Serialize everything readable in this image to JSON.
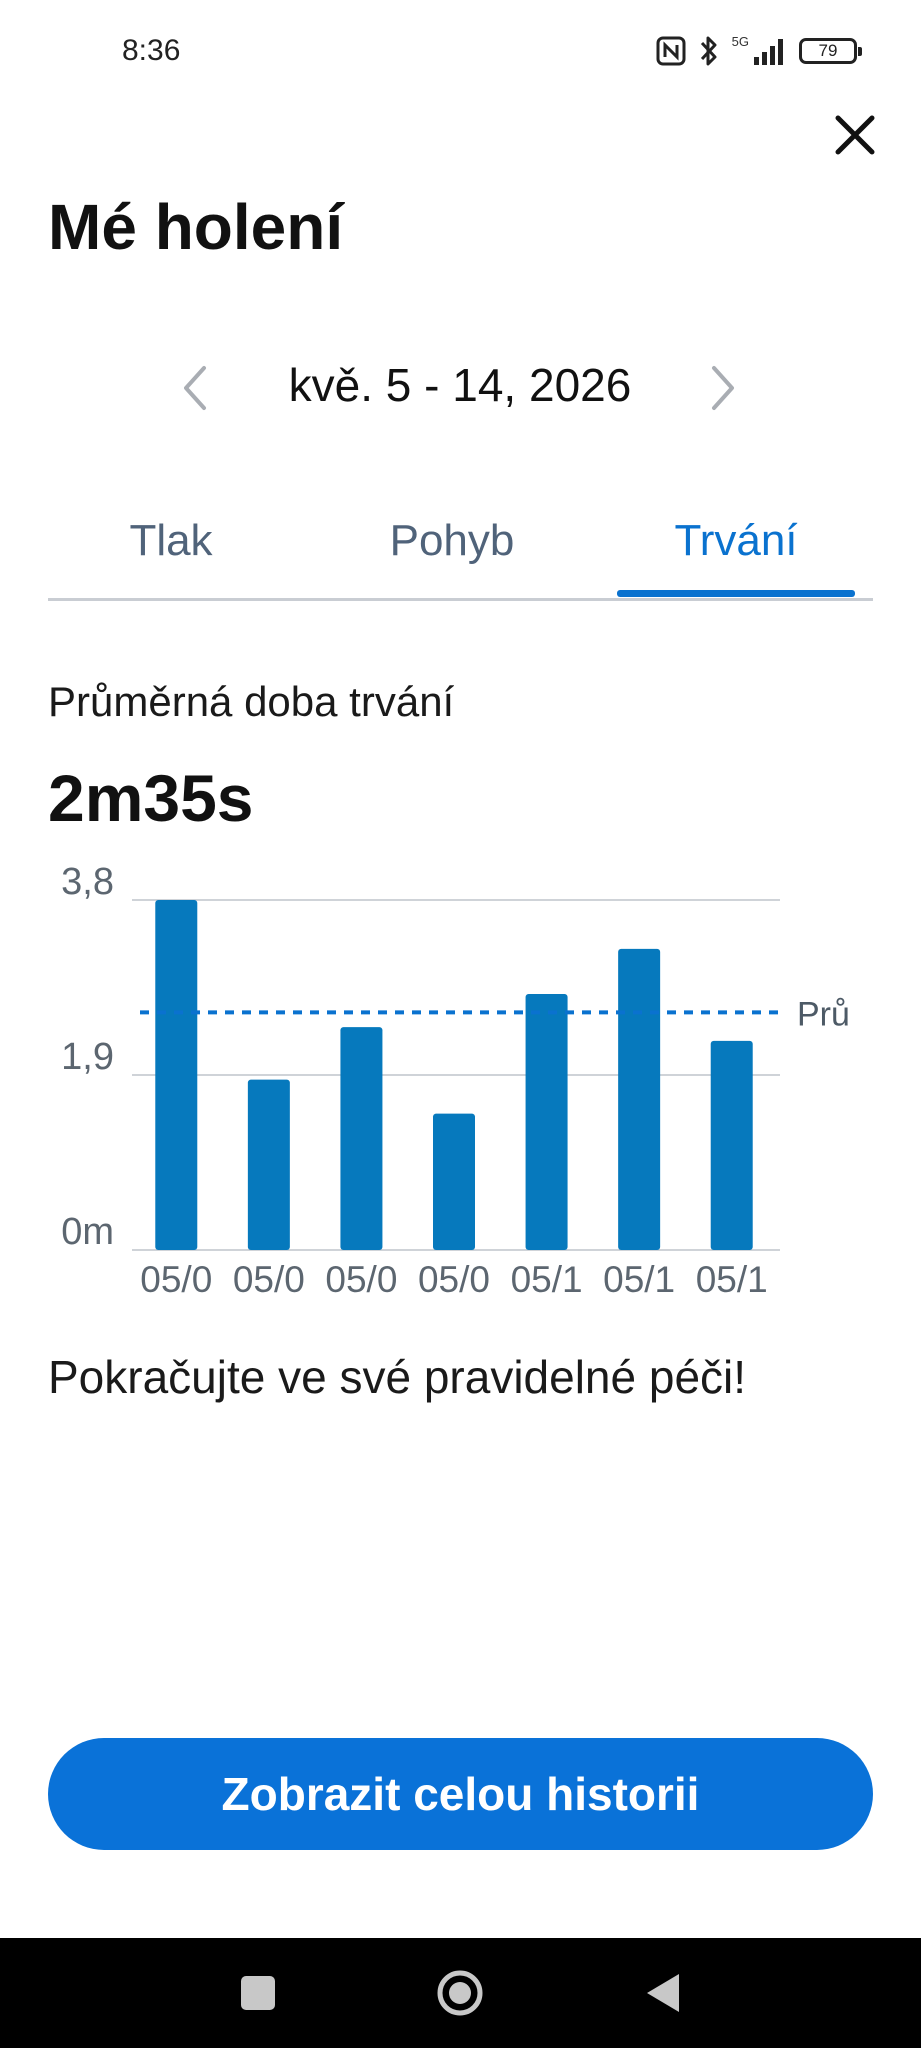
{
  "status_bar": {
    "time": "8:36",
    "network_label": "5G",
    "battery_level": "79",
    "icons": [
      "nfc-icon",
      "bluetooth-icon",
      "signal-icon",
      "battery-icon"
    ]
  },
  "header": {
    "title": "Mé holení",
    "close_icon": "close-icon"
  },
  "date_nav": {
    "range": "kvě. 5 - 14, 2026",
    "prev_icon": "chevron-left-icon",
    "next_icon": "chevron-right-icon"
  },
  "tabs": [
    {
      "label": "Tlak",
      "active": false
    },
    {
      "label": "Pohyb",
      "active": false
    },
    {
      "label": "Trvání",
      "active": true
    }
  ],
  "metric": {
    "label": "Průměrná doba trvání",
    "value": "2m35s"
  },
  "chart_data": {
    "type": "bar",
    "categories": [
      "05/0",
      "05/0",
      "05/0",
      "05/0",
      "05/1",
      "05/1",
      "05/1"
    ],
    "values": [
      3.8,
      1.85,
      2.42,
      1.48,
      2.78,
      3.27,
      2.27
    ],
    "y_tick_labels": [
      "3,8",
      "1,9",
      "0m"
    ],
    "y_ticks": [
      3.8,
      1.9,
      0
    ],
    "ylim": [
      0,
      3.8
    ],
    "reference_line": {
      "value": 2.58,
      "label": "Prů"
    },
    "bar_color": "#0679bd",
    "reference_color": "#0a72cf",
    "grid": true
  },
  "tip": {
    "text": "Pokračujte ve své pravidelné péči!"
  },
  "actions": {
    "history_label": "Zobrazit celou historii"
  },
  "nav_bar": {
    "icons": [
      "recents-icon",
      "home-icon",
      "back-icon"
    ]
  },
  "colors": {
    "accent": "#0a72cf",
    "button": "#0a72d8",
    "tab_inactive": "#50637a"
  }
}
